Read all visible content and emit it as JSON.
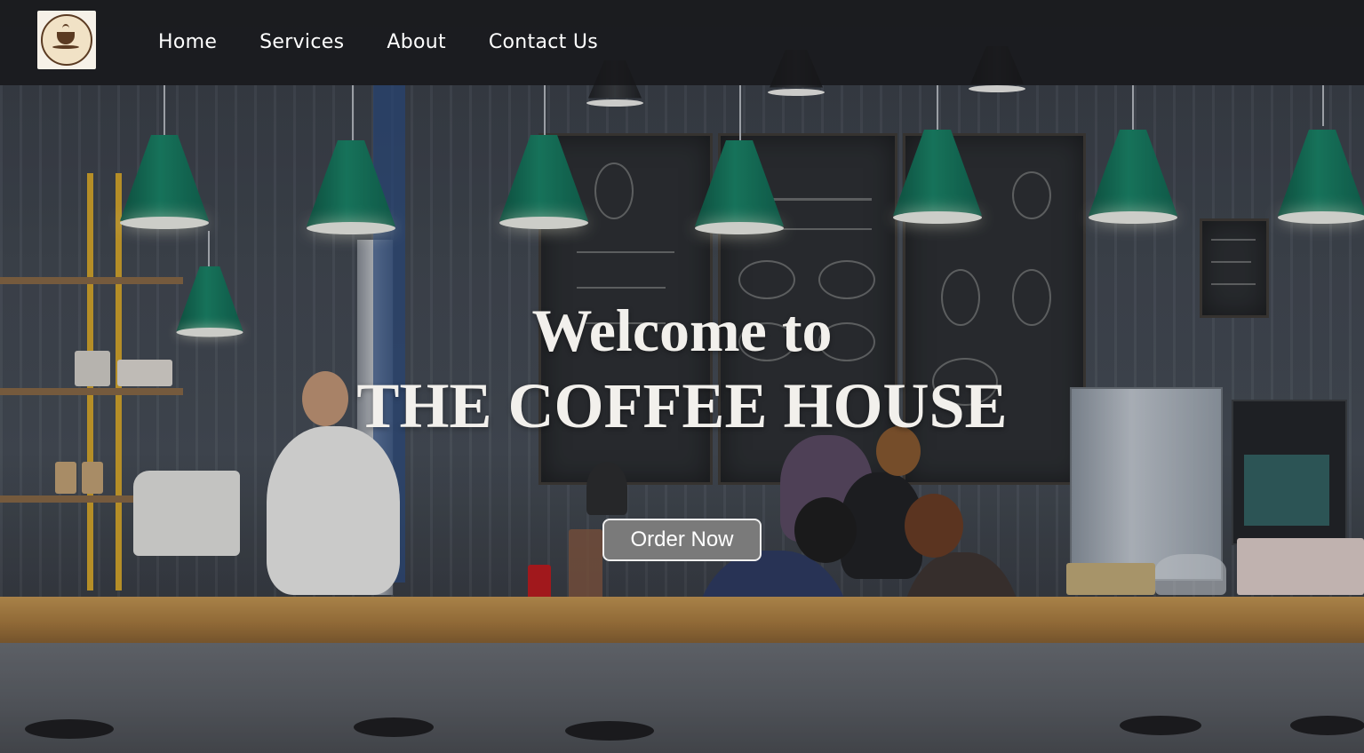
{
  "nav": {
    "logo_icon": "coffee-cup-logo",
    "links": [
      {
        "label": "Home"
      },
      {
        "label": "Services"
      },
      {
        "label": "About"
      },
      {
        "label": "Contact Us"
      }
    ]
  },
  "hero": {
    "line1": "Welcome to",
    "line2": "THE COFFEE HOUSE",
    "cta_label": "Order Now"
  },
  "colors": {
    "navbar_bg": "#161618",
    "button_bg": "#7a7a7a",
    "hero_text": "#f2f0ec"
  }
}
